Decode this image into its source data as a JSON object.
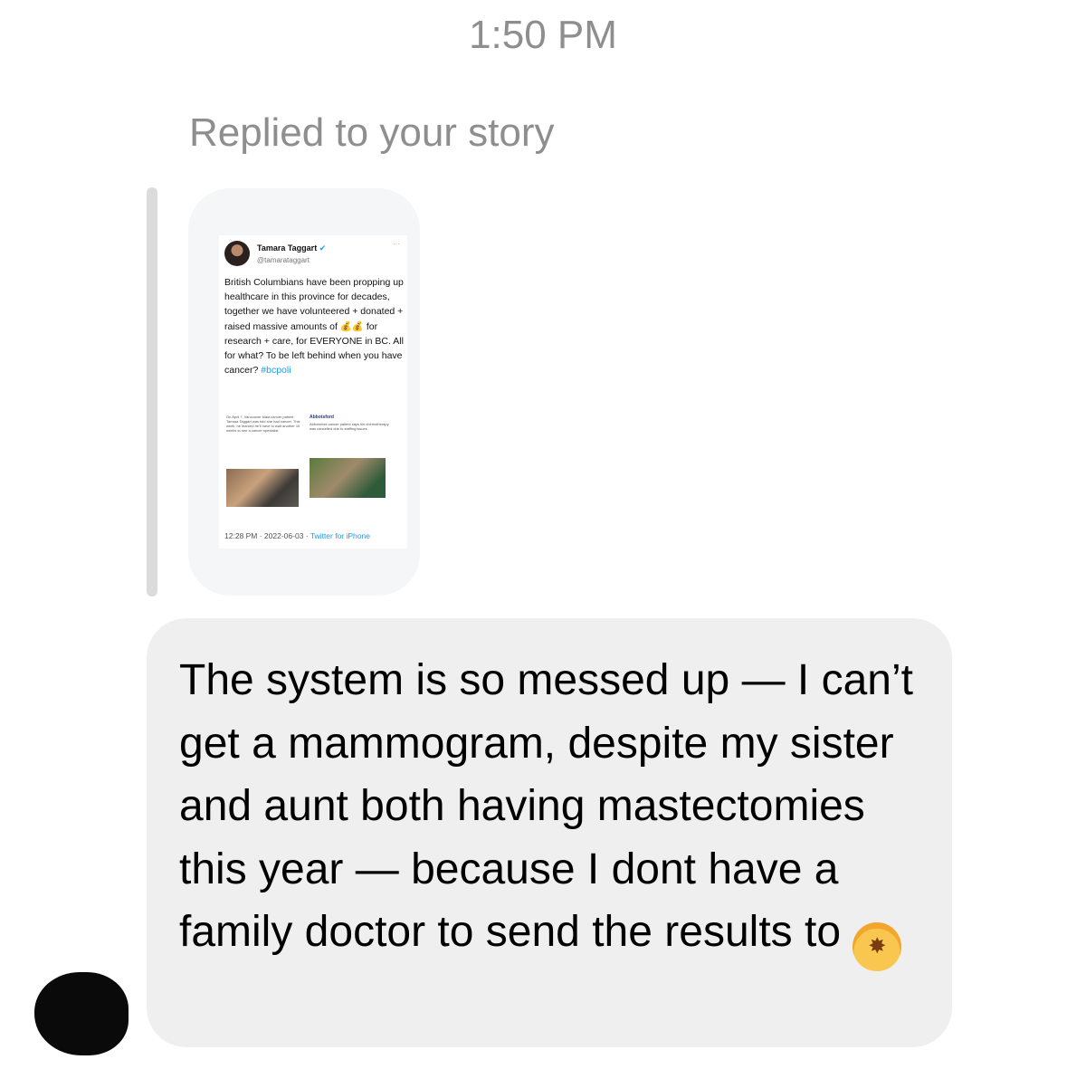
{
  "timestamp": "1:50 PM",
  "reply_label": "Replied to your story",
  "story": {
    "tweet": {
      "name": "Tamara Taggart",
      "handle": "@tamarataggart",
      "more": "···",
      "body": "British Columbians have been propping up healthcare in this province for decades, together we have volunteered + donated + raised massive amounts of 💰💰 for research + care, for EVERYONE in BC. All for what? To be left behind when you have cancer?",
      "hashtag": "#bcpoli",
      "media_left_text": "On April 7, Vancouver blast cancer patient Tamara Taggart was told she had cancer. This week, he learned he'll have to wait another 10 weeks to see a cancer specialist.",
      "media_right_logo": "Abbotsford",
      "media_right_text": "Abbotsford cancer patient says his chemotherapy was cancelled due to staffing issues",
      "footer_time": "12:28 PM · 2022-06-03 · ",
      "footer_app": "Twitter for iPhone"
    }
  },
  "message": {
    "text": "The system is so messed up — I can’t get a mammogram, despite my sister and aunt both having mastectomies this year — because I dont have a family doctor to send the results to",
    "emoji": "exploding-head"
  }
}
